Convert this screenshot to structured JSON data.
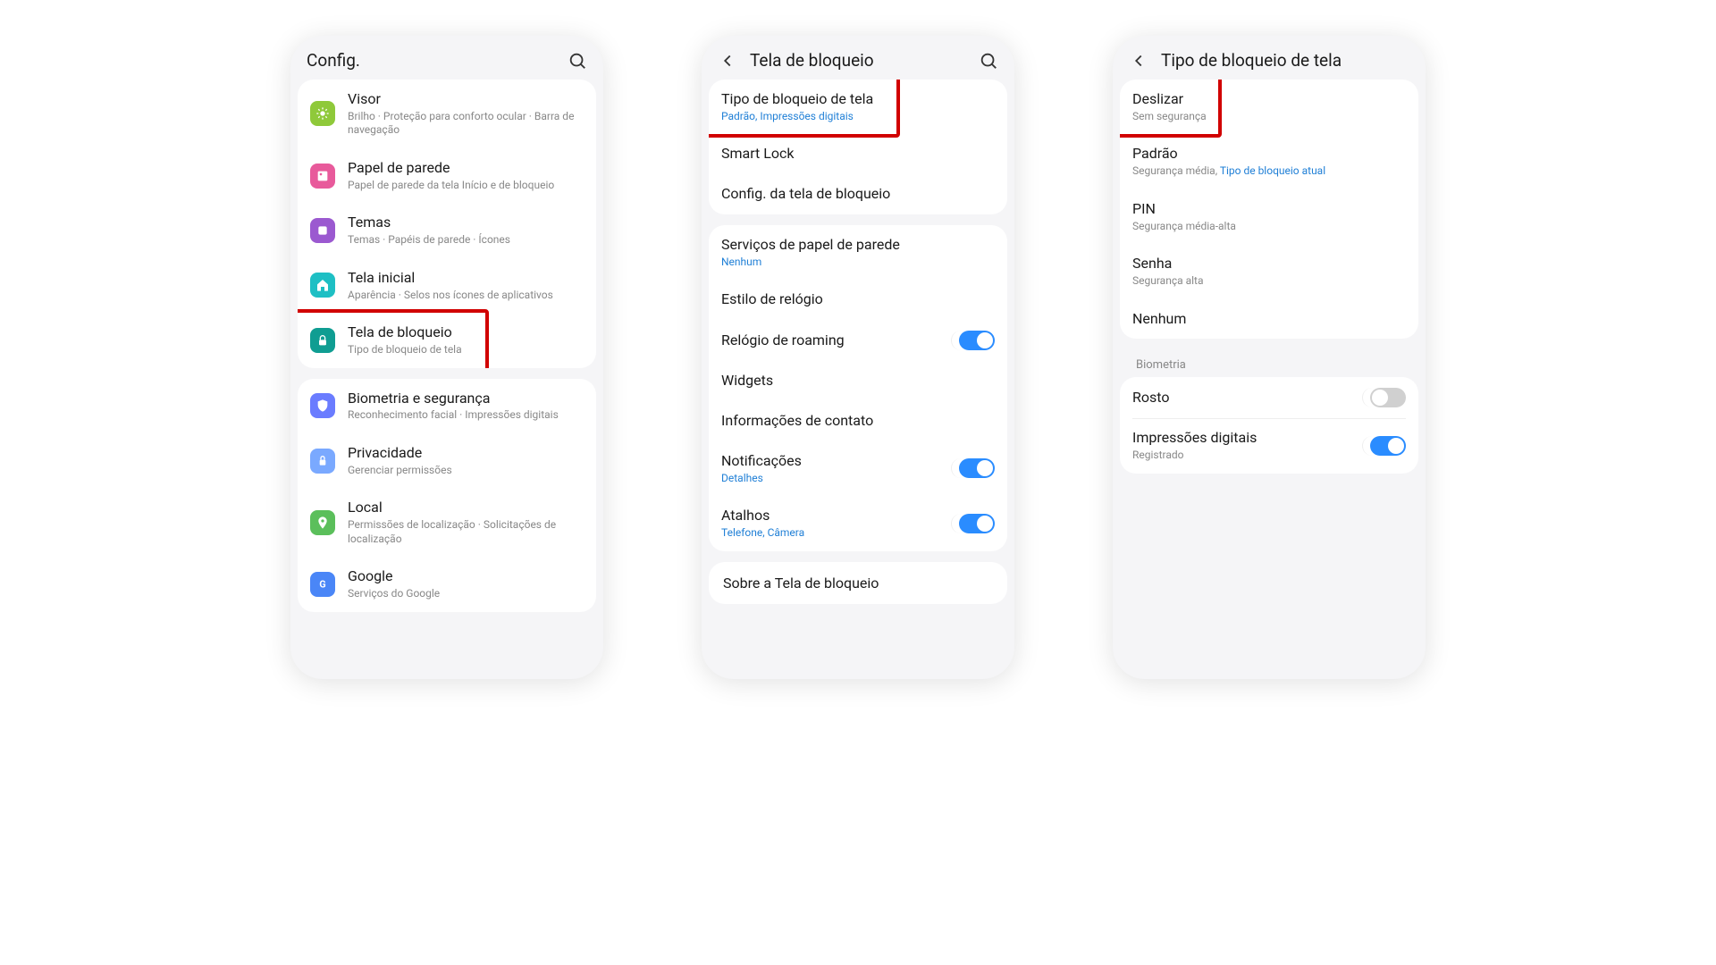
{
  "phone1": {
    "header": {
      "title": "Config."
    },
    "groups": [
      {
        "items": [
          {
            "key": "visor",
            "title": "Visor",
            "sub": "Brilho · Proteção para conforto ocular · Barra de navegação",
            "icon": "sun",
            "color": "#8fc93a"
          },
          {
            "key": "wallpaper",
            "title": "Papel de parede",
            "sub": "Papel de parede da tela Início e de bloqueio",
            "icon": "image",
            "color": "#e85a9b"
          },
          {
            "key": "themes",
            "title": "Temas",
            "sub": "Temas · Papéis de parede · Ícones",
            "icon": "palette",
            "color": "#9b59d0"
          },
          {
            "key": "home",
            "title": "Tela inicial",
            "sub": "Aparência · Selos nos ícones de aplicativos",
            "icon": "home",
            "color": "#1ebfc4"
          },
          {
            "key": "lock",
            "title": "Tela de bloqueio",
            "sub": "Tipo de bloqueio de tela",
            "icon": "lock",
            "color": "#0f9d92",
            "highlight": true
          }
        ]
      },
      {
        "items": [
          {
            "key": "biometrics",
            "title": "Biometria e segurança",
            "sub": "Reconhecimento facial · Impressões digitais",
            "icon": "shield",
            "color": "#6a7cff"
          },
          {
            "key": "privacy",
            "title": "Privacidade",
            "sub": "Gerenciar permissões",
            "icon": "privacy",
            "color": "#7aa9ff"
          },
          {
            "key": "location",
            "title": "Local",
            "sub": "Permissões de localização · Solicitações de localização",
            "icon": "pin",
            "color": "#5bbf5b"
          },
          {
            "key": "google",
            "title": "Google",
            "sub": "Serviços do Google",
            "icon": "google",
            "color": "#4a86f7"
          }
        ]
      }
    ]
  },
  "phone2": {
    "header": {
      "title": "Tela de bloqueio"
    },
    "groups": [
      {
        "items": [
          {
            "key": "lock-type",
            "title": "Tipo de bloqueio de tela",
            "sub": "Padrão, Impressões digitais",
            "subLink": true,
            "highlight": true
          },
          {
            "key": "smart-lock",
            "title": "Smart Lock"
          },
          {
            "key": "lock-config",
            "title": "Config. da tela de bloqueio"
          }
        ]
      },
      {
        "items": [
          {
            "key": "wallpaper-svc",
            "title": "Serviços de papel de parede",
            "sub": "Nenhum",
            "subLink": true
          },
          {
            "key": "clock-style",
            "title": "Estilo de relógio"
          },
          {
            "key": "roaming-clock",
            "title": "Relógio de roaming",
            "toggle": true
          },
          {
            "key": "widgets",
            "title": "Widgets"
          },
          {
            "key": "contact-info",
            "title": "Informações de contato"
          },
          {
            "key": "notifications",
            "title": "Notificações",
            "sub": "Detalhes",
            "subLink": true,
            "toggle": true
          },
          {
            "key": "shortcuts",
            "title": "Atalhos",
            "sub": "Telefone, Câmera",
            "subLink": true,
            "toggle": true
          }
        ]
      }
    ],
    "about": "Sobre a Tela de bloqueio"
  },
  "phone3": {
    "header": {
      "title": "Tipo de bloqueio de tela"
    },
    "groups": [
      {
        "items": [
          {
            "key": "swipe",
            "title": "Deslizar",
            "sub": "Sem segurança",
            "highlight": true
          },
          {
            "key": "pattern",
            "title": "Padrão",
            "subHtml": true,
            "subPlain": "Segurança média, ",
            "subLinkText": "Tipo de bloqueio atual"
          },
          {
            "key": "pin",
            "title": "PIN",
            "sub": "Segurança média-alta"
          },
          {
            "key": "password",
            "title": "Senha",
            "sub": "Segurança alta"
          },
          {
            "key": "none",
            "title": "Nenhum"
          }
        ]
      }
    ],
    "biometricsLabel": "Biometria",
    "biometrics": [
      {
        "key": "face",
        "title": "Rosto",
        "toggle": false
      },
      {
        "key": "fingerprint",
        "title": "Impressões digitais",
        "sub": "Registrado",
        "toggle": true
      }
    ]
  }
}
